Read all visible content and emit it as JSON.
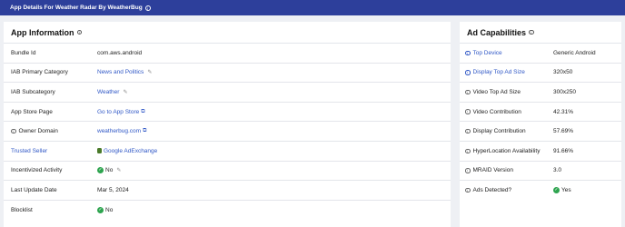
{
  "topbar": {
    "title": "App Details For Weather Radar By WeatherBug",
    "info": "i"
  },
  "app_info": {
    "title": "App Information",
    "info": "i",
    "rows": [
      {
        "label": "Bundle Id",
        "value": "com.aws.android"
      },
      {
        "label": "IAB Primary Category",
        "value": "News and Politics"
      },
      {
        "label": "IAB Subcategory",
        "value": "Weather"
      },
      {
        "label": "App Store Page",
        "value": "Go to App Store"
      },
      {
        "label": "Owner Domain",
        "value": "weatherbug.com"
      },
      {
        "label": "Trusted Seller",
        "value": "Google AdExchange"
      },
      {
        "label": "Incentivized Activity",
        "value": "No"
      },
      {
        "label": "Last Update Date",
        "value": "Mar 5, 2024"
      },
      {
        "label": "Blocklist",
        "value": "No"
      }
    ]
  },
  "ad_caps": {
    "title": "Ad Capabilities",
    "info": "i",
    "rows": [
      {
        "label": "Top Device",
        "value": "Generic Android"
      },
      {
        "label": "Display Top Ad Size",
        "value": "320x50"
      },
      {
        "label": "Video Top Ad Size",
        "value": "300x250"
      },
      {
        "label": "Video Contribution",
        "value": "42.31%"
      },
      {
        "label": "Display Contribution",
        "value": "57.69%"
      },
      {
        "label": "HyperLocation Availability",
        "value": "91.66%"
      },
      {
        "label": "MRAID Version",
        "value": "3.0"
      },
      {
        "label": "Ads Detected?",
        "value": "Yes"
      }
    ]
  },
  "glyphs": {
    "check": "✓",
    "pencil": "✎",
    "external": "⧉",
    "info": "i"
  }
}
